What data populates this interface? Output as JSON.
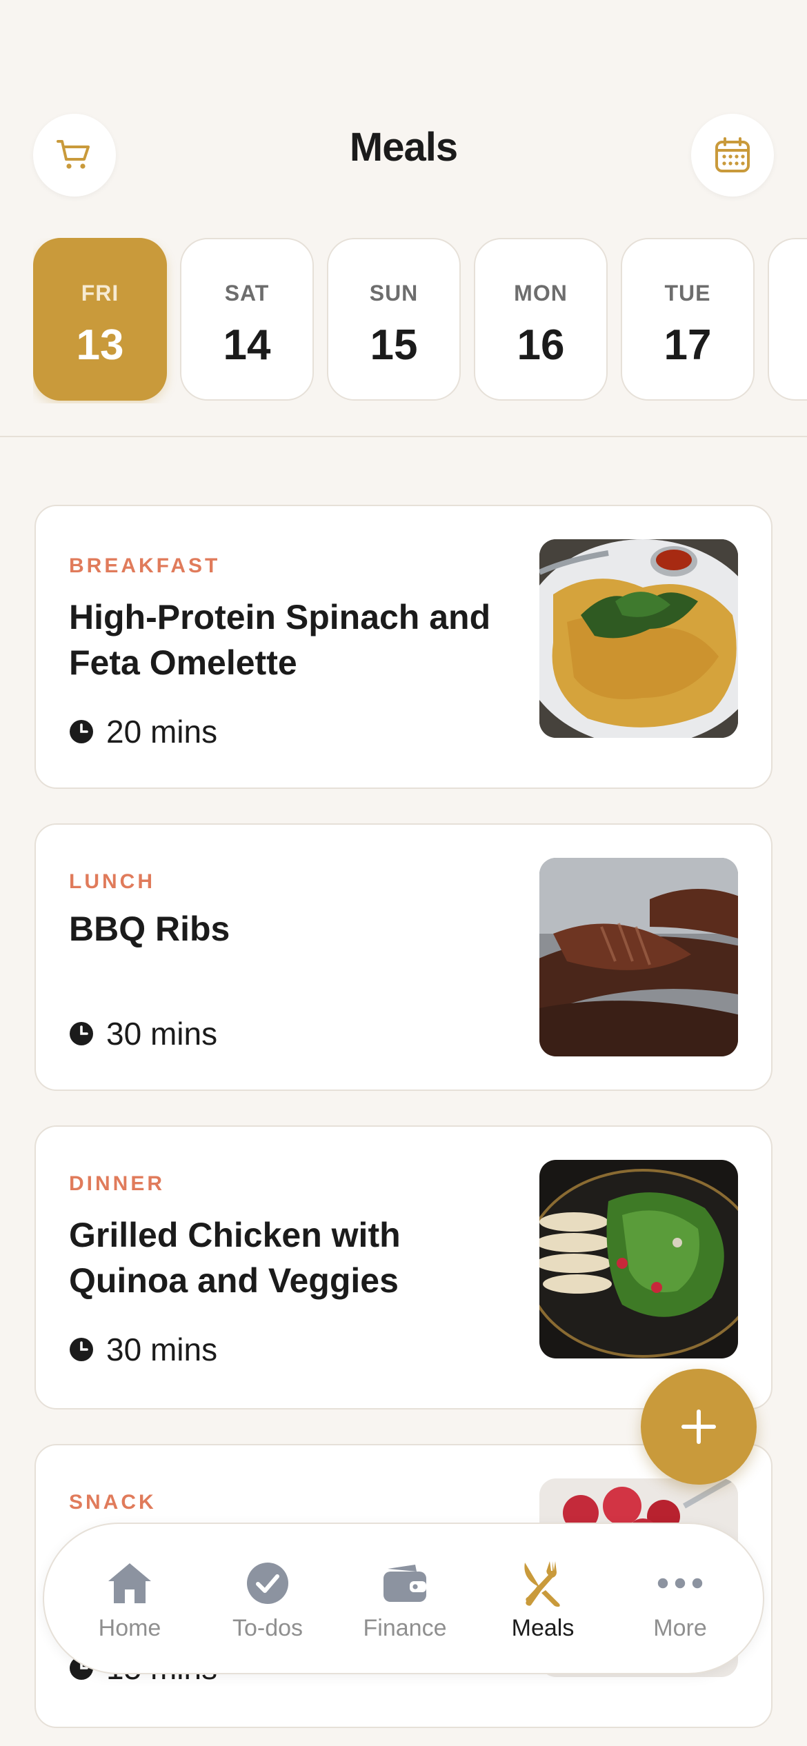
{
  "header": {
    "title": "Meals"
  },
  "days": [
    {
      "dow": "FRI",
      "num": "13",
      "active": true
    },
    {
      "dow": "SAT",
      "num": "14"
    },
    {
      "dow": "SUN",
      "num": "15"
    },
    {
      "dow": "MON",
      "num": "16"
    },
    {
      "dow": "TUE",
      "num": "17"
    }
  ],
  "meals": [
    {
      "type": "BREAKFAST",
      "name": "High-Protein Spinach and Feta Omelette",
      "time": "20 mins"
    },
    {
      "type": "LUNCH",
      "name": "BBQ Ribs",
      "time": "30 mins"
    },
    {
      "type": "DINNER",
      "name": "Grilled Chicken with Quinoa and Veggies",
      "time": "30 mins"
    },
    {
      "type": "SNACK",
      "name": "",
      "time": "15 mins"
    }
  ],
  "tabs": [
    {
      "label": "Home",
      "icon": "home-icon"
    },
    {
      "label": "To-dos",
      "icon": "check-circle-icon"
    },
    {
      "label": "Finance",
      "icon": "wallet-icon"
    },
    {
      "label": "Meals",
      "icon": "fork-knife-icon",
      "active": true
    },
    {
      "label": "More",
      "icon": "more-icon"
    }
  ],
  "colors": {
    "accent": "#c99a3b",
    "meal_type": "#e07b5b",
    "background": "#f8f5f1"
  }
}
